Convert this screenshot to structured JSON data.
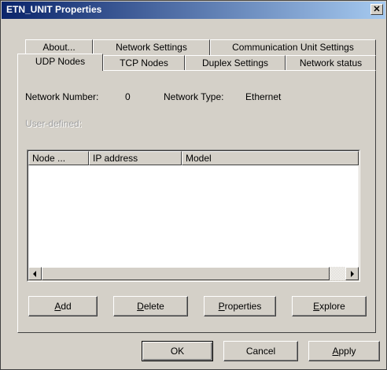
{
  "window": {
    "title": "ETN_UNIT Properties",
    "close_glyph": "✕"
  },
  "tabs_row1": [
    {
      "label": "About..."
    },
    {
      "label": "Network Settings"
    },
    {
      "label": "Communication Unit Settings"
    }
  ],
  "tabs_row2": [
    {
      "label": "UDP Nodes"
    },
    {
      "label": "TCP Nodes"
    },
    {
      "label": "Duplex Settings"
    },
    {
      "label": "Network status"
    }
  ],
  "active_tab": "UDP Nodes",
  "info": {
    "network_number_label": "Network Number:",
    "network_number_value": "0",
    "network_type_label": "Network Type:",
    "network_type_value": "Ethernet",
    "user_defined_label": "User-defined:"
  },
  "list": {
    "columns": [
      "Node ...",
      "IP address",
      "Model"
    ],
    "rows": []
  },
  "buttons": {
    "add": {
      "pre": "",
      "key": "A",
      "post": "dd"
    },
    "delete": {
      "pre": "",
      "key": "D",
      "post": "elete"
    },
    "properties": {
      "pre": "",
      "key": "P",
      "post": "roperties"
    },
    "explore": {
      "pre": "",
      "key": "E",
      "post": "xplore"
    }
  },
  "footer": {
    "ok": "OK",
    "cancel": "Cancel",
    "apply": {
      "pre": "",
      "key": "A",
      "post": "pply"
    }
  }
}
